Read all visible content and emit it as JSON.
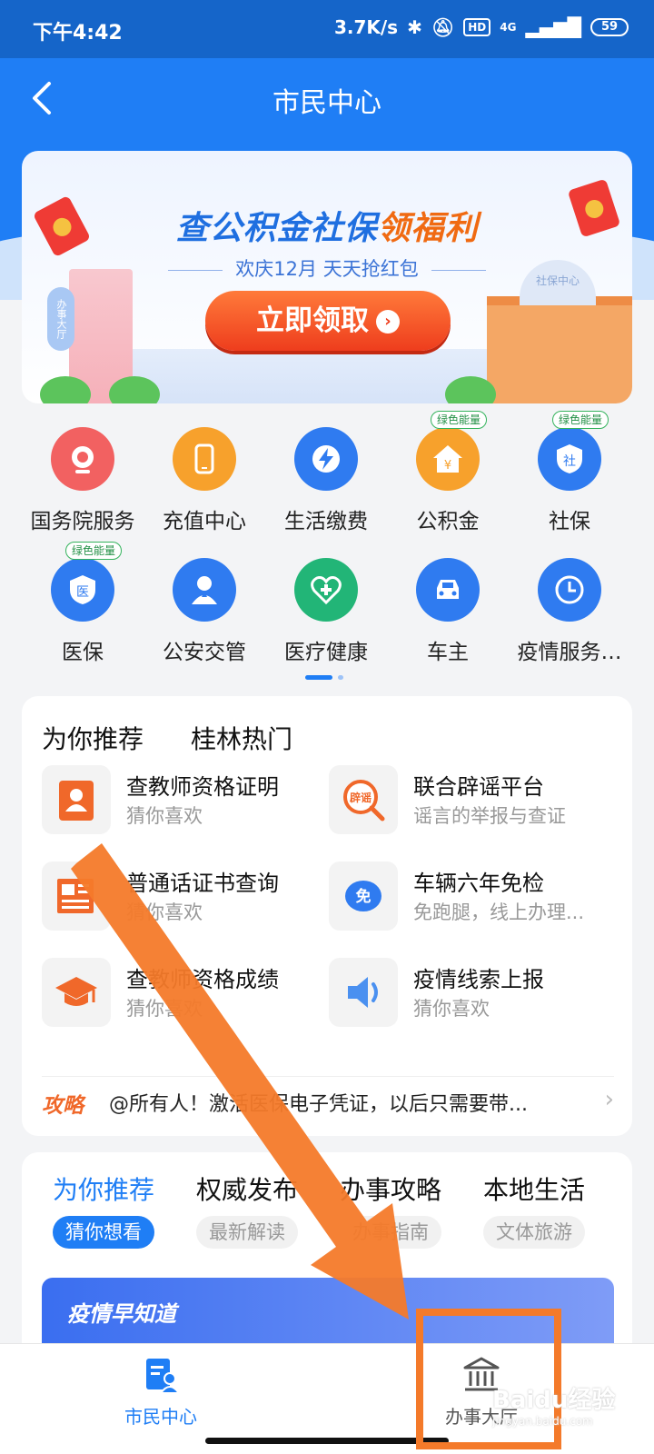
{
  "status_bar": {
    "time": "下午4:42",
    "speed": "3.7K/s",
    "hd": "HD",
    "network": "4G",
    "battery": "59"
  },
  "nav": {
    "title": "市民中心"
  },
  "banner": {
    "title_main": "查公积金社保",
    "title_highlight": "领福利",
    "subtitle": "欢庆12月 天天抢红包",
    "button": "立即领取",
    "left_building_sign": "办事大厅",
    "right_building_sign": "社保中心"
  },
  "services": [
    {
      "label": "国务院服务",
      "icon": "camera-icon",
      "color": "#f26161"
    },
    {
      "label": "充值中心",
      "icon": "phone-icon",
      "color": "#f7a12c"
    },
    {
      "label": "生活缴费",
      "icon": "lightning-icon",
      "color": "#2f7bf0"
    },
    {
      "label": "公积金",
      "icon": "house-yuan-icon",
      "color": "#f7a12c",
      "tag": "绿色能量"
    },
    {
      "label": "社保",
      "icon": "shield-she-icon",
      "color": "#2f7bf0",
      "tag": "绿色能量"
    },
    {
      "label": "医保",
      "icon": "shield-yi-icon",
      "color": "#2f7bf0",
      "tag": "绿色能量"
    },
    {
      "label": "公安交管",
      "icon": "police-icon",
      "color": "#2f7bf0"
    },
    {
      "label": "医疗健康",
      "icon": "health-icon",
      "color": "#22b577"
    },
    {
      "label": "车主",
      "icon": "car-icon",
      "color": "#2f7bf0"
    },
    {
      "label": "疫情服务…",
      "icon": "clock-icon",
      "color": "#2f7bf0"
    }
  ],
  "recommend": {
    "tabs": [
      "为你推荐",
      "桂林热门"
    ],
    "items": [
      {
        "title": "查教师资格证明",
        "subtitle": "猜你喜欢",
        "icon": "id-card-icon"
      },
      {
        "title": "联合辟谣平台",
        "subtitle": "谣言的举报与查证",
        "icon": "rumor-search-icon"
      },
      {
        "title": "普通话证书查询",
        "subtitle": "猜你喜欢",
        "icon": "newspaper-icon"
      },
      {
        "title": "车辆六年免检",
        "subtitle": "免跑腿，线上办理...",
        "icon": "free-check-icon"
      },
      {
        "title": "查教师资格成绩",
        "subtitle": "猜你喜欢",
        "icon": "graduation-cap-icon"
      },
      {
        "title": "疫情线索上报",
        "subtitle": "猜你喜欢",
        "icon": "speaker-icon"
      }
    ],
    "strategy_tag": "攻略",
    "strategy_text": "@所有人！激活医保电子凭证，以后只需要带..."
  },
  "feed": {
    "tabs": [
      "为你推荐",
      "权威发布",
      "办事攻略",
      "本地生活"
    ],
    "subtabs": [
      "猜你想看",
      "最新解读",
      "办事指南",
      "文体旅游"
    ],
    "banner_text": "疫情早知道"
  },
  "tabbar": [
    {
      "label": "市民中心",
      "icon": "citizen-doc-icon",
      "color": "#1f7ef5"
    },
    {
      "label": "办事大厅",
      "icon": "bank-building-icon",
      "color": "#555555"
    }
  ],
  "watermark": {
    "brand": "Baidu经验",
    "url": "jingyan.baidu.com"
  },
  "colors": {
    "primary": "#1f7ef5",
    "annotation": "#f47a2a",
    "green_tag": "#34b35c"
  }
}
